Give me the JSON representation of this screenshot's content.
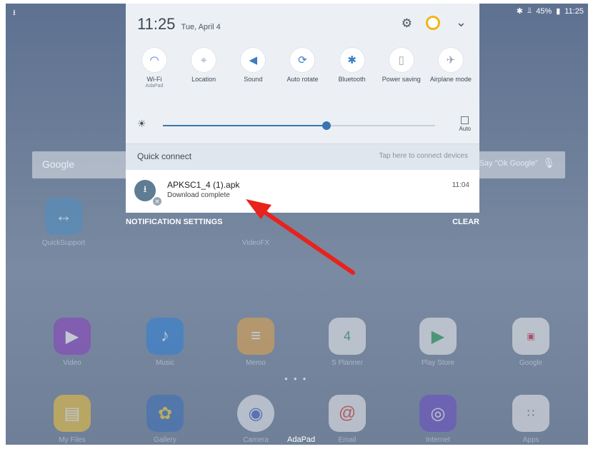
{
  "status": {
    "battery": "45%",
    "time": "11:25"
  },
  "panel": {
    "time": "11:25",
    "date": "Tue, April 4",
    "tiles": [
      {
        "label": "Wi-Fi",
        "sub": "AdaPad"
      },
      {
        "label": "Location"
      },
      {
        "label": "Sound"
      },
      {
        "label": "Auto rotate"
      },
      {
        "label": "Bluetooth"
      },
      {
        "label": "Power saving"
      },
      {
        "label": "Airplane mode"
      }
    ],
    "brightness": {
      "level": 0.6,
      "auto_label": "Auto"
    },
    "quick_connect": {
      "title": "Quick connect",
      "hint": "Tap here to connect devices"
    }
  },
  "notification": {
    "title": "APKSC1_4 (1).apk",
    "body": "Download complete",
    "time": "11:04"
  },
  "actions": {
    "settings": "NOTIFICATION SETTINGS",
    "clear": "CLEAR"
  },
  "home": {
    "google_logo": "Google",
    "google_hint": "Say \"Ok Google\"",
    "carrier": "AdaPad",
    "apps": [
      "QuickSupport",
      "VideoFX",
      "Video",
      "Music",
      "Memo",
      "S Planner",
      "Play Store",
      "Google",
      "My Files",
      "Gallery",
      "Camera",
      "Email",
      "Internet",
      "Apps"
    ]
  },
  "colors": {
    "accent": "#3a75b0",
    "arrow": "#e8221c"
  }
}
